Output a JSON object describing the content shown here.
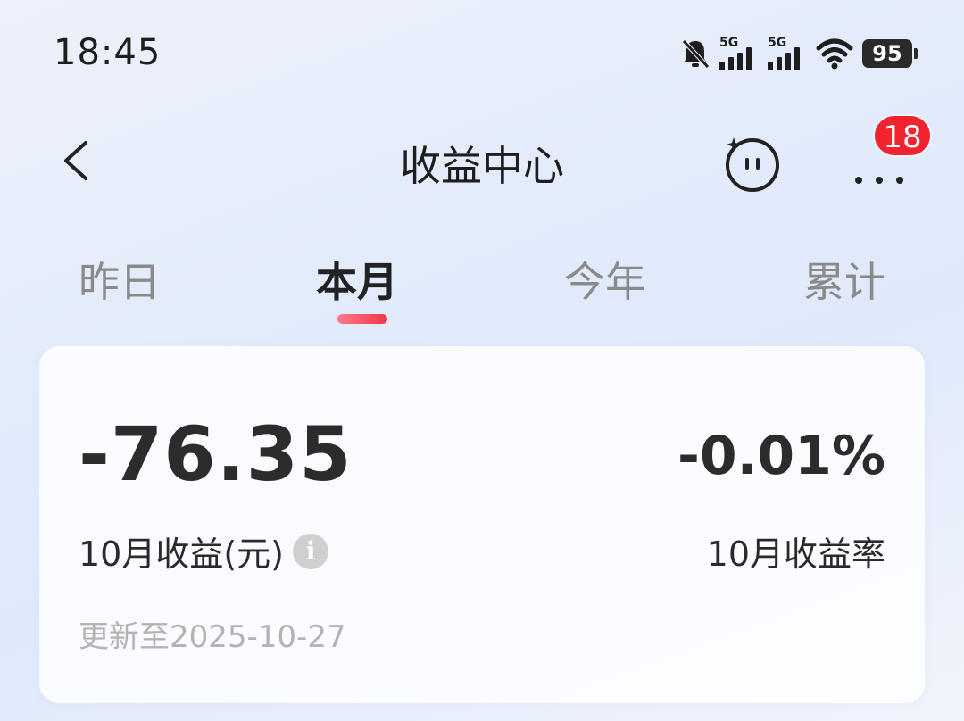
{
  "status_bar": {
    "time": "18:45",
    "signal1_label": "5G",
    "signal2_label": "5G",
    "battery": "95"
  },
  "header": {
    "title": "收益中心",
    "badge_count": "18"
  },
  "tabs": [
    {
      "label": "昨日",
      "active": false
    },
    {
      "label": "本月",
      "active": true
    },
    {
      "label": "今年",
      "active": false
    },
    {
      "label": "累计",
      "active": false
    }
  ],
  "summary": {
    "amount": "-76.35",
    "amount_label": "10月收益(元)",
    "rate": "-0.01%",
    "rate_label": "10月收益率",
    "updated": "更新至2025-10-27"
  },
  "colors": {
    "accent": "#f0364a",
    "badge": "#f0232f"
  }
}
